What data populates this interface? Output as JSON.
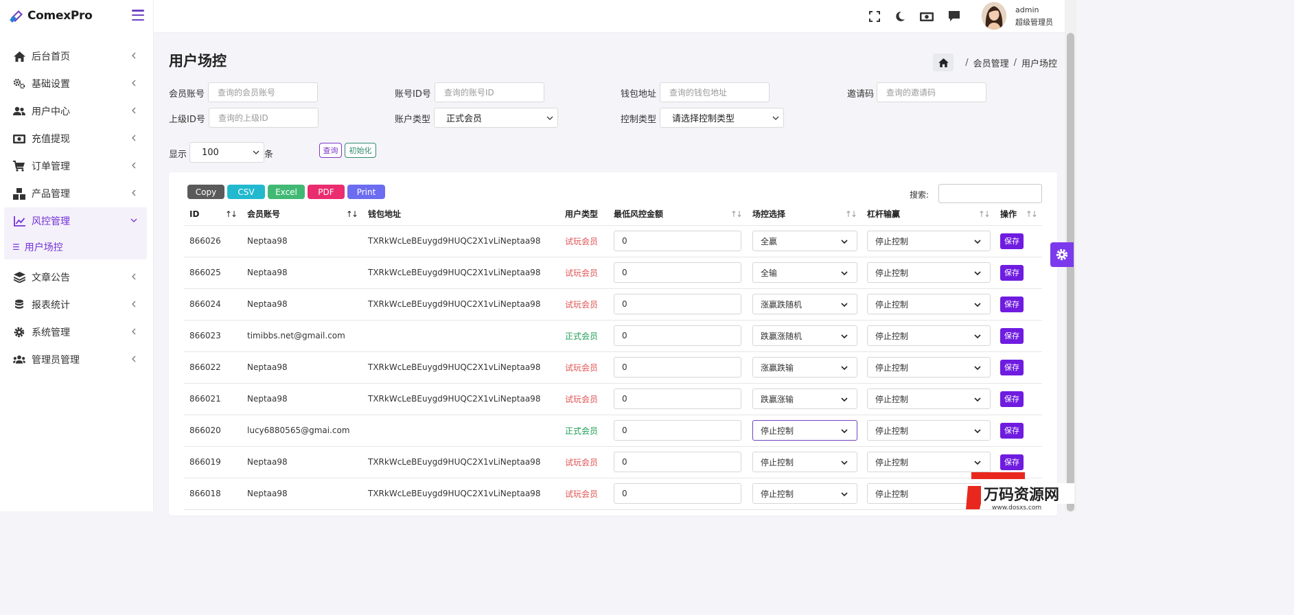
{
  "brand": {
    "name": "ComexPro"
  },
  "sidebar": {
    "items": [
      {
        "label": "后台首页",
        "icon": "home-icon"
      },
      {
        "label": "基础设置",
        "icon": "cogs-icon"
      },
      {
        "label": "用户中心",
        "icon": "users-icon"
      },
      {
        "label": "充值提现",
        "icon": "money-bill-icon"
      },
      {
        "label": "订单管理",
        "icon": "cart-icon"
      },
      {
        "label": "产品管理",
        "icon": "cubes-icon"
      },
      {
        "label": "风控管理",
        "icon": "chart-line-icon",
        "active": true
      },
      {
        "label": "文章公告",
        "icon": "layers-icon"
      },
      {
        "label": "报表统计",
        "icon": "coins-icon"
      },
      {
        "label": "系统管理",
        "icon": "gear-icon"
      },
      {
        "label": "管理员管理",
        "icon": "user-group-icon"
      }
    ],
    "sub_item": {
      "label": "用户场控"
    }
  },
  "user": {
    "name": "admin",
    "role": "超级管理员"
  },
  "page": {
    "title": "用户场控"
  },
  "breadcrumb": {
    "item1": "会员管理",
    "item2": "用户场控"
  },
  "filters": {
    "member_account": {
      "label": "会员账号",
      "placeholder": "查询的会员账号"
    },
    "account_id": {
      "label": "账号ID号",
      "placeholder": "查询的账号ID"
    },
    "wallet": {
      "label": "钱包地址",
      "placeholder": "查询的钱包地址"
    },
    "invite": {
      "label": "邀请码",
      "placeholder": "查询的邀请码"
    },
    "parent_id": {
      "label": "上级ID号",
      "placeholder": "查询的上级ID"
    },
    "account_type": {
      "label": "账户类型",
      "value": "正式会员"
    },
    "control_type": {
      "label": "控制类型",
      "value": "请选择控制类型"
    },
    "show_label": "显示",
    "show_value": "100",
    "show_unit": "条",
    "query_button": "查询",
    "reset_button": "初始化"
  },
  "export": {
    "copy": "Copy",
    "csv": "CSV",
    "excel": "Excel",
    "pdf": "PDF",
    "print": "Print",
    "colors": {
      "copy": "#5a5a5a",
      "csv": "#22b9cf",
      "excel": "#41b974",
      "pdf": "#ea2d6f",
      "print": "#6c6cf0"
    }
  },
  "search": {
    "label": "搜索:"
  },
  "table": {
    "headers": [
      "ID",
      "会员账号",
      "钱包地址",
      "用户类型",
      "最低风控金额",
      "场控选择",
      "杠杆输赢",
      "操作"
    ],
    "save_label": "保存",
    "rows": [
      {
        "id": "866026",
        "account": "Neptaa98",
        "wallet": "TXRkWcLeBEuygd9HUQC2X1vLiNeptaa98",
        "type": "试玩会员",
        "type_kind": "trial",
        "amount": "0",
        "control": "全赢",
        "leverage": "停止控制"
      },
      {
        "id": "866025",
        "account": "Neptaa98",
        "wallet": "TXRkWcLeBEuygd9HUQC2X1vLiNeptaa98",
        "type": "试玩会员",
        "type_kind": "trial",
        "amount": "0",
        "control": "全输",
        "leverage": "停止控制"
      },
      {
        "id": "866024",
        "account": "Neptaa98",
        "wallet": "TXRkWcLeBEuygd9HUQC2X1vLiNeptaa98",
        "type": "试玩会员",
        "type_kind": "trial",
        "amount": "0",
        "control": "涨赢跌随机",
        "leverage": "停止控制"
      },
      {
        "id": "866023",
        "account": "timibbs.net@gmail.com",
        "wallet": "",
        "type": "正式会员",
        "type_kind": "real",
        "amount": "0",
        "control": "跌赢涨随机",
        "leverage": "停止控制"
      },
      {
        "id": "866022",
        "account": "Neptaa98",
        "wallet": "TXRkWcLeBEuygd9HUQC2X1vLiNeptaa98",
        "type": "试玩会员",
        "type_kind": "trial",
        "amount": "0",
        "control": "涨赢跌输",
        "leverage": "停止控制"
      },
      {
        "id": "866021",
        "account": "Neptaa98",
        "wallet": "TXRkWcLeBEuygd9HUQC2X1vLiNeptaa98",
        "type": "试玩会员",
        "type_kind": "trial",
        "amount": "0",
        "control": "跌赢涨输",
        "leverage": "停止控制"
      },
      {
        "id": "866020",
        "account": "lucy6880565@gmai.com",
        "wallet": "",
        "type": "正式会员",
        "type_kind": "real",
        "amount": "0",
        "control": "停止控制",
        "leverage": "停止控制",
        "focused": true
      },
      {
        "id": "866019",
        "account": "Neptaa98",
        "wallet": "TXRkWcLeBEuygd9HUQC2X1vLiNeptaa98",
        "type": "试玩会员",
        "type_kind": "trial",
        "amount": "0",
        "control": "停止控制",
        "leverage": "停止控制"
      },
      {
        "id": "866018",
        "account": "Neptaa98",
        "wallet": "TXRkWcLeBEuygd9HUQC2X1vLiNeptaa98",
        "type": "试玩会员",
        "type_kind": "trial",
        "amount": "0",
        "control": "停止控制",
        "leverage": "停止控制"
      }
    ]
  },
  "watermark": {
    "text": "万码资源网",
    "url": "www.dosxs.com"
  },
  "colors": {
    "accent": "#6f42c1",
    "save": "#6f1ce0",
    "trial": "#e05252",
    "real": "#1f9d55"
  }
}
